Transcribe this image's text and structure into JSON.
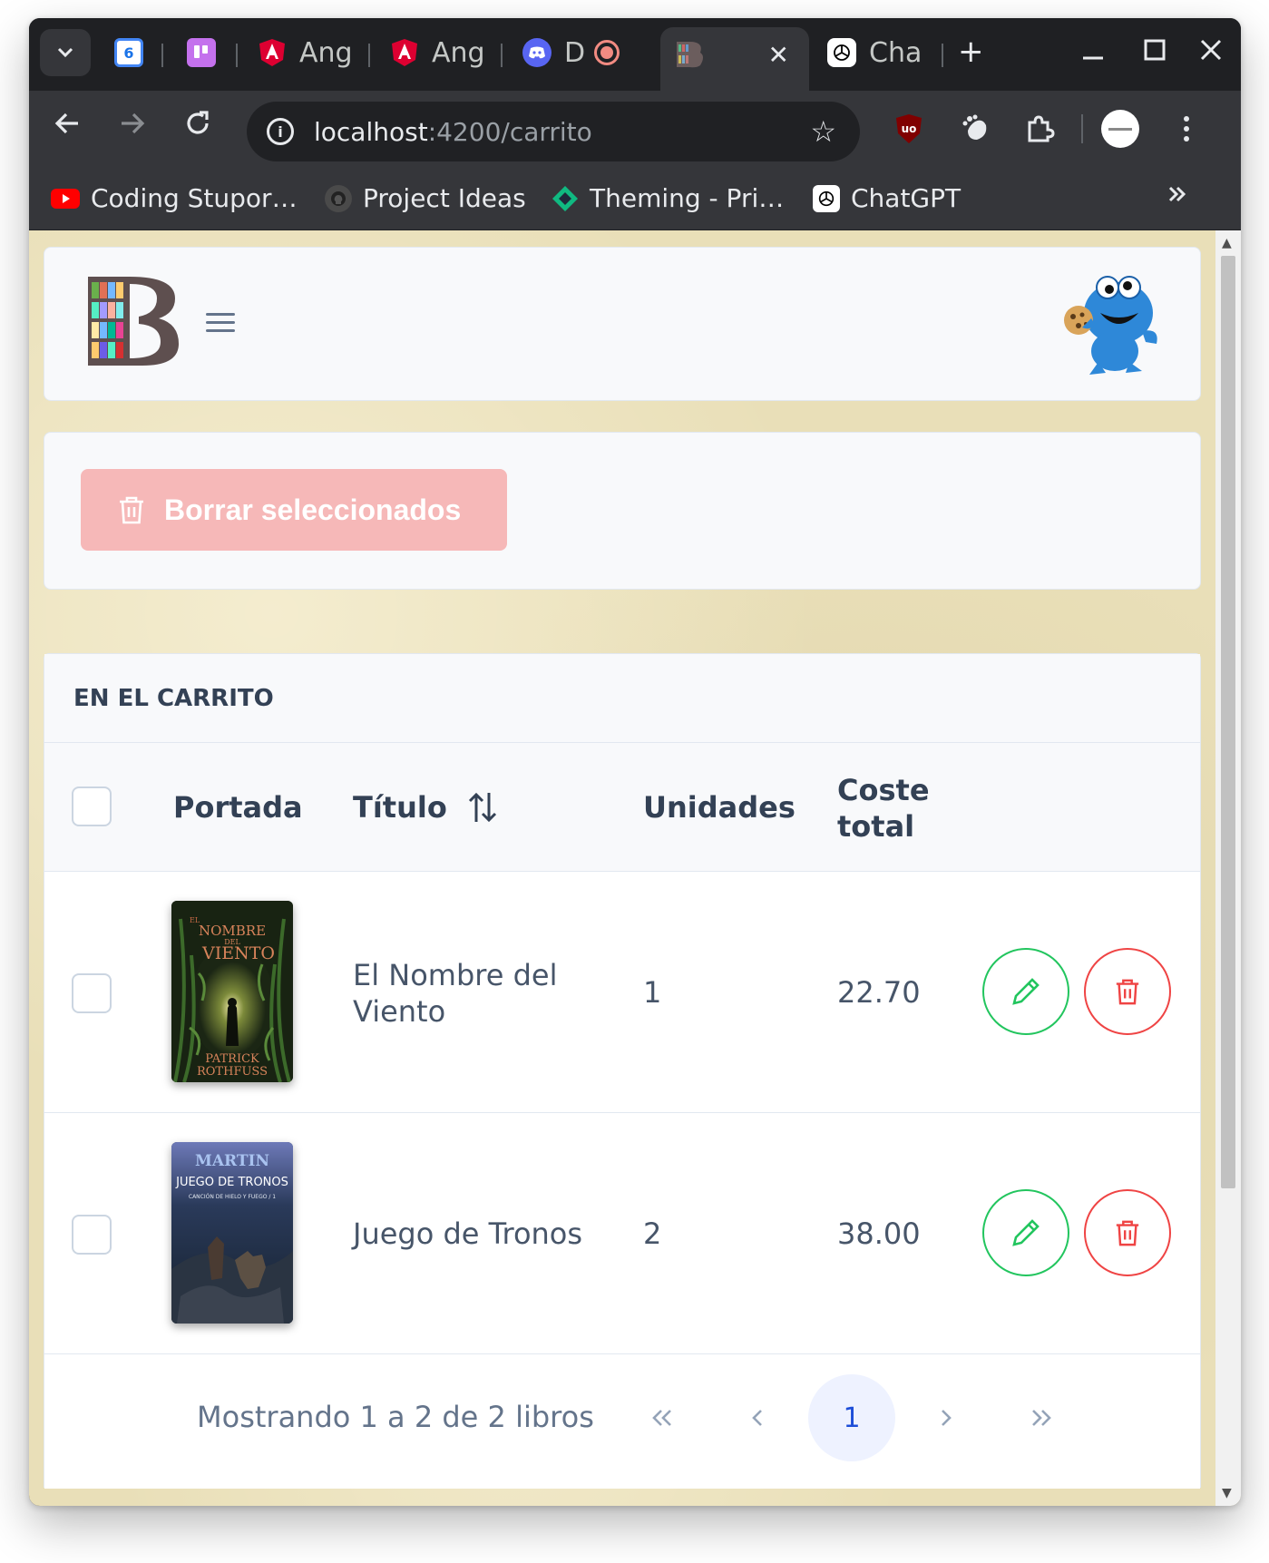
{
  "browser": {
    "tabs": [
      {
        "label": "",
        "icon": "google-calendar-icon"
      },
      {
        "label": "",
        "icon": "trello-icon"
      },
      {
        "label": "Ang",
        "icon": "angular-shield-icon"
      },
      {
        "label": "Ang",
        "icon": "angular-shield-icon"
      },
      {
        "label": "D",
        "icon": "discord-icon"
      },
      {
        "label": "",
        "icon": "books-logo-icon",
        "active": true
      },
      {
        "label": "Cha",
        "icon": "chatgpt-icon"
      }
    ],
    "calendar_day": "6",
    "url_host": "localhost",
    "url_path": ":4200/carrito",
    "bookmarks": [
      {
        "label": "Coding Stupor…",
        "icon": "youtube-icon"
      },
      {
        "label": "Project Ideas",
        "icon": "github-icon"
      },
      {
        "label": "Theming - Pri…",
        "icon": "primeng-icon"
      },
      {
        "label": "ChatGPT",
        "icon": "chatgpt-icon"
      }
    ]
  },
  "app": {
    "delete_selected_label": "Borrar seleccionados",
    "table_caption": "EN EL CARRITO",
    "columns": {
      "cover": "Portada",
      "title": "Título",
      "units": "Unidades",
      "total_line1": "Coste",
      "total_line2": "total"
    },
    "rows": [
      {
        "title_line1": "El Nombre del",
        "title_line2": "Viento",
        "units": "1",
        "total": "22.70",
        "cover": {
          "top": "EL",
          "line1": "NOMBRE",
          "line2": "DEL",
          "line3": "VIENTO",
          "author1": "PATRICK",
          "author2": "ROTHFUSS"
        }
      },
      {
        "title_line1": "Juego de Tronos",
        "title_line2": "",
        "units": "2",
        "total": "38.00",
        "cover": {
          "top": "MARTIN",
          "line1": "JUEGO DE TRONOS",
          "line2": "CANCIÓN DE HIELO Y FUEGO / 1"
        }
      }
    ],
    "paginator": {
      "summary": "Mostrando 1 a 2 de 2 libros",
      "current_page": "1"
    }
  },
  "colors": {
    "danger": "#ef4444",
    "success": "#22c55e",
    "primary": "#1d4ed8"
  }
}
